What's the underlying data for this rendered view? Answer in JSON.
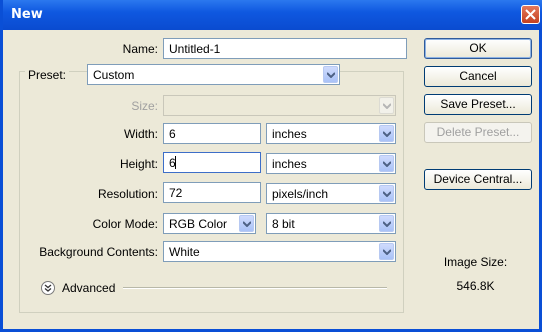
{
  "window": {
    "title": "New"
  },
  "form": {
    "name": {
      "label": "Name:",
      "value": "Untitled-1"
    },
    "preset": {
      "label": "Preset:",
      "value": "Custom"
    },
    "size": {
      "label": "Size:",
      "value": ""
    },
    "width": {
      "label": "Width:",
      "value": "6",
      "unit": "inches"
    },
    "height": {
      "label": "Height:",
      "value": "6",
      "unit": "inches"
    },
    "resolution": {
      "label": "Resolution:",
      "value": "72",
      "unit": "pixels/inch"
    },
    "color_mode": {
      "label": "Color Mode:",
      "value": "RGB Color",
      "depth": "8 bit"
    },
    "background": {
      "label": "Background Contents:",
      "value": "White"
    },
    "advanced_label": "Advanced"
  },
  "buttons": {
    "ok": "OK",
    "cancel": "Cancel",
    "save_preset": "Save Preset...",
    "delete_preset": "Delete Preset...",
    "device_central": "Device Central..."
  },
  "info": {
    "image_size_label": "Image Size:",
    "image_size_value": "546.8K"
  },
  "colors": {
    "titlebar": "#0a4bd0",
    "dialog_bg": "#ece9d8",
    "close_button": "#c4401f"
  }
}
